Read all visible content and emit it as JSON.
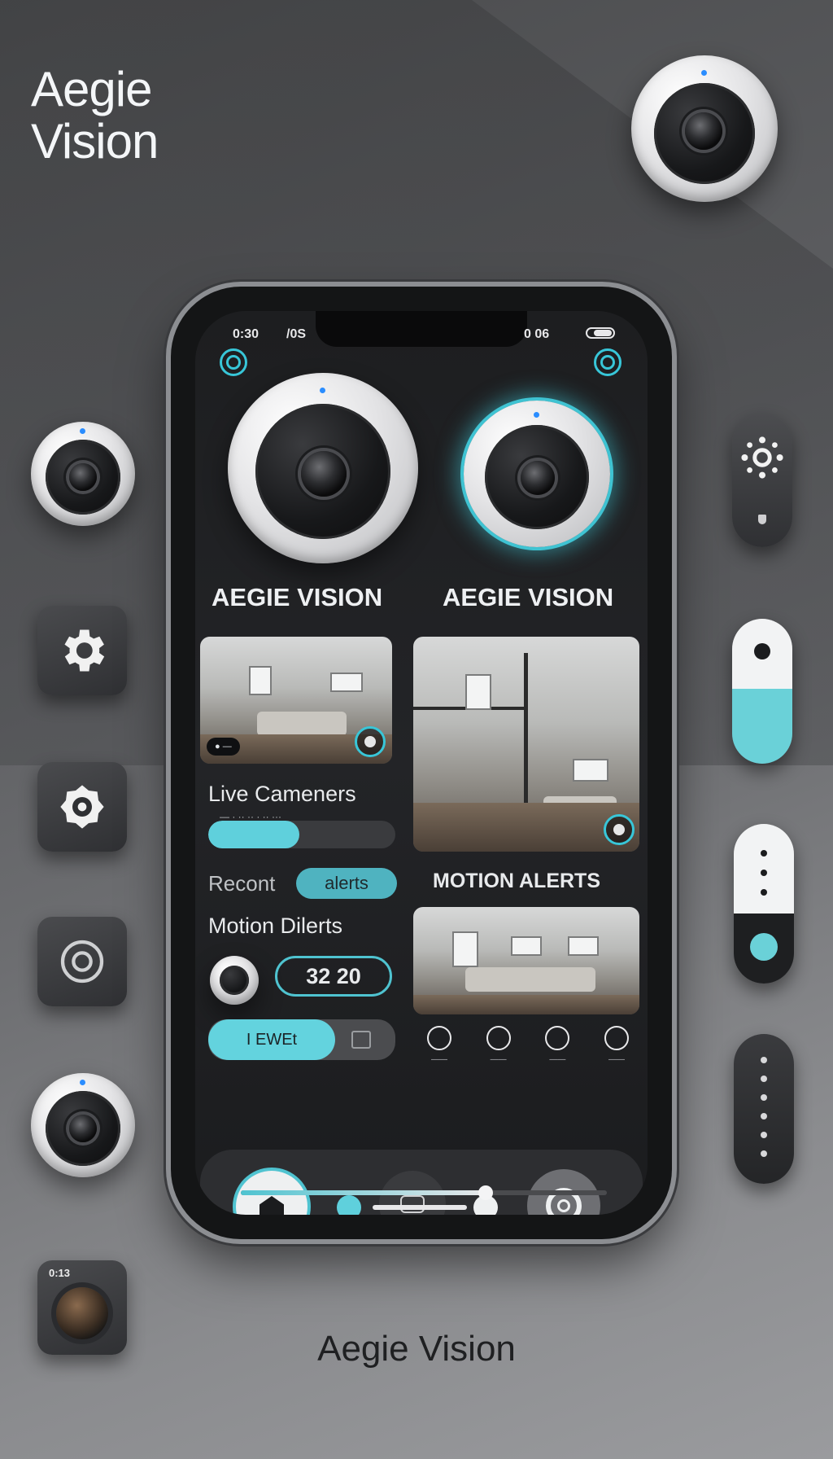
{
  "brand": {
    "title_line1": "Aegie",
    "title_line2": "Vision",
    "footer": "Aegie Vision"
  },
  "status_bar": {
    "time": "0:30",
    "carrier": "/0S",
    "right": "0 06"
  },
  "screen": {
    "camera_labels": [
      "AEGIE VISION",
      "AEGIE VISION"
    ],
    "live_cameras_heading": "Live Cameners",
    "live_cameras_sub": "— · ·· ·· · ·· ···",
    "recent_label": "Recont",
    "alerts_pill": "alerts",
    "motion_alerts_heading": "MOTION ALERTS",
    "motion_dilerts": "Motion Dilerts",
    "counter": "32 20",
    "view_button": "I EWEt",
    "feed_tag": "● —",
    "action_labels": [
      "——",
      "——",
      "——",
      "——"
    ]
  },
  "side_tile_label": "0:13"
}
